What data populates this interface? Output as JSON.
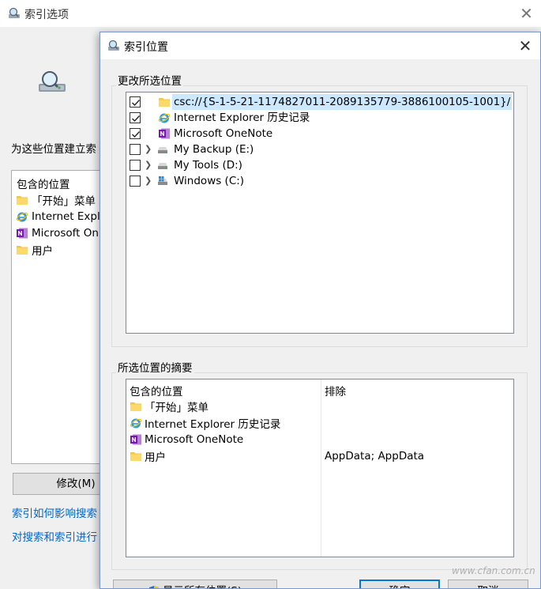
{
  "back_window": {
    "title": "索引选项",
    "prompt": "为这些位置建立索",
    "list_header": "包含的位置",
    "items": [
      {
        "label": "「开始」菜单",
        "icon": "folder-icon"
      },
      {
        "label": "Internet Explo",
        "icon": "internet-explorer-icon"
      },
      {
        "label": "Microsoft On",
        "icon": "onenote-icon"
      },
      {
        "label": "用户",
        "icon": "folder-icon"
      }
    ],
    "modify_button": "修改(M)",
    "link_1": "索引如何影响搜索",
    "link_2": "对搜索和索引进行"
  },
  "dialog": {
    "title": "索引位置",
    "change_group_label": "更改所选位置",
    "tree": [
      {
        "label": "csc://{S-1-5-21-1174827011-2089135779-3886100105-1001}/",
        "checked": true,
        "expandable": false,
        "icon": "folder-icon",
        "selected": true
      },
      {
        "label": "Internet Explorer 历史记录",
        "checked": true,
        "expandable": false,
        "icon": "internet-explorer-icon",
        "selected": false
      },
      {
        "label": "Microsoft OneNote",
        "checked": true,
        "expandable": false,
        "icon": "onenote-icon",
        "selected": false
      },
      {
        "label": "My Backup (E:)",
        "checked": false,
        "expandable": true,
        "icon": "drive-icon",
        "selected": false
      },
      {
        "label": "My Tools (D:)",
        "checked": false,
        "expandable": true,
        "icon": "drive-icon",
        "selected": false
      },
      {
        "label": "Windows (C:)",
        "checked": false,
        "expandable": true,
        "icon": "windows-drive-icon",
        "selected": false
      }
    ],
    "summary_group_label": "所选位置的摘要",
    "summary_header_included": "包含的位置",
    "summary_header_excluded": "排除",
    "summary_rows": [
      {
        "label": "「开始」菜单",
        "icon": "folder-icon",
        "exclude": ""
      },
      {
        "label": "Internet Explorer 历史记录",
        "icon": "internet-explorer-icon",
        "exclude": ""
      },
      {
        "label": "Microsoft OneNote",
        "icon": "onenote-icon",
        "exclude": ""
      },
      {
        "label": "用户",
        "icon": "folder-icon",
        "exclude": "AppData; AppData"
      }
    ],
    "show_all_button": "显示所有位置(S)",
    "ok_button": "确定",
    "cancel_button": "取消"
  },
  "watermark": "www.cfan.com.cn",
  "colors": {
    "accent": "#0078d7",
    "link": "#0066cc",
    "selection": "#cce8ff"
  }
}
